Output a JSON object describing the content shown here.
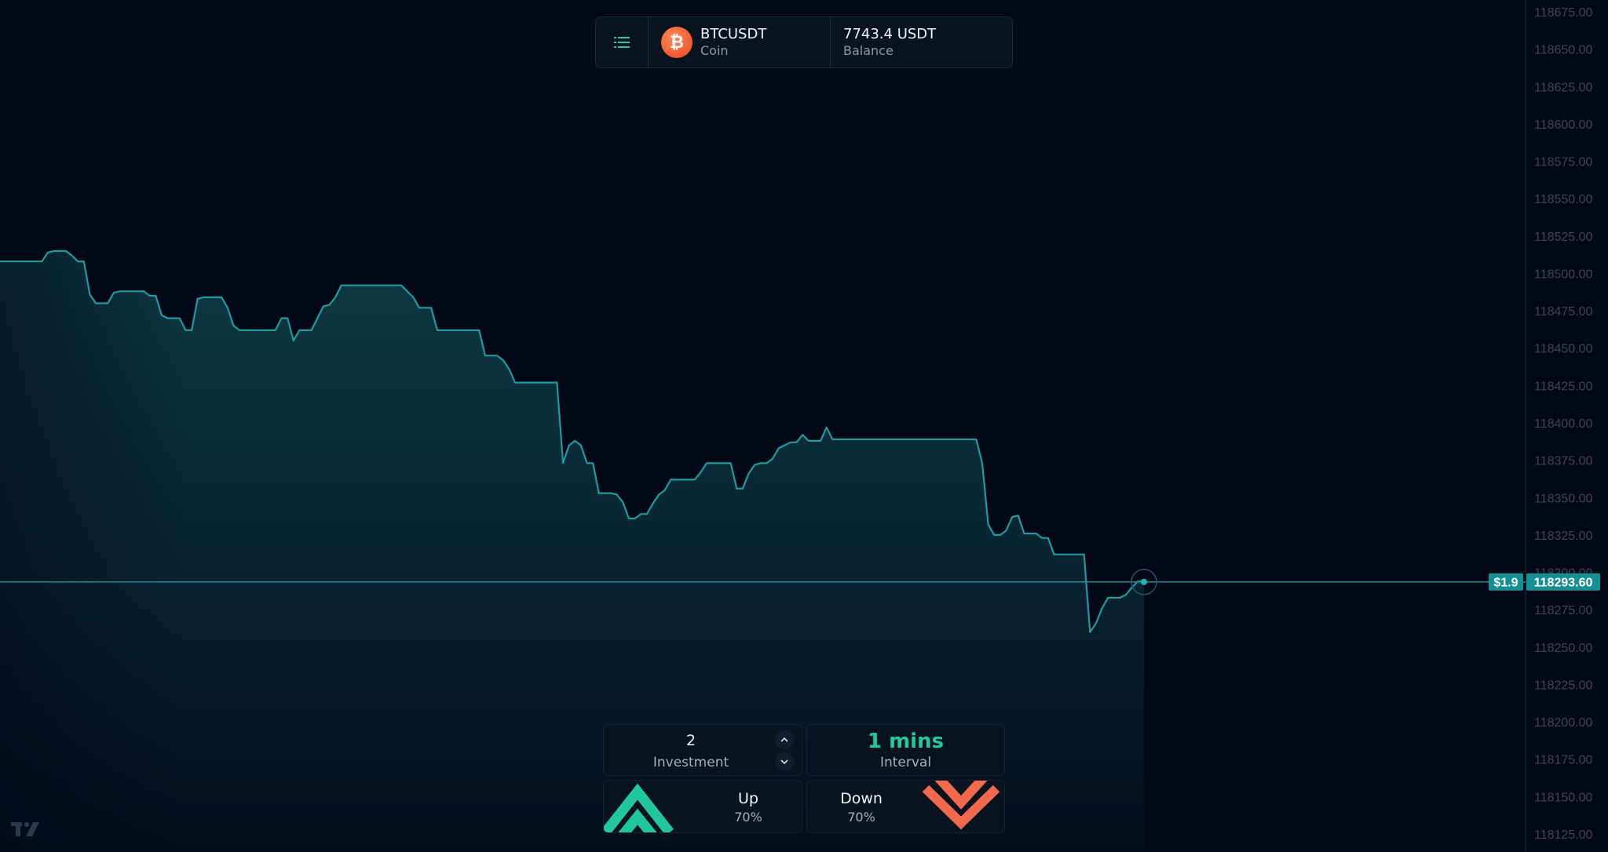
{
  "header": {
    "coin_symbol": "BTCUSDT",
    "coin_label": "Coin",
    "balance_value": "7743.4 USDT",
    "balance_label": "Balance",
    "menu_icon": "list-icon",
    "coin_icon": "bitcoin-icon"
  },
  "controls": {
    "investment_value": "2",
    "investment_label": "Investment",
    "interval_value": "1 mins",
    "interval_label": "Interval",
    "up_label": "Up",
    "up_payout": "70%",
    "down_label": "Down",
    "down_payout": "70%"
  },
  "colors": {
    "line": "#1e9aa0",
    "up": "#1fc79a",
    "down": "#f2694d",
    "background": "#020816"
  },
  "chart_data": {
    "type": "area",
    "y_axis_ticks": [
      "118675.00",
      "118650.00",
      "118625.00",
      "118600.00",
      "118575.00",
      "118550.00",
      "118525.00",
      "118500.00",
      "118475.00",
      "118450.00",
      "118425.00",
      "118400.00",
      "118375.00",
      "118350.00",
      "118325.00",
      "118300.00",
      "118275.00",
      "118250.00",
      "118225.00",
      "118200.00",
      "118175.00",
      "118150.00",
      "118125.00"
    ],
    "ylim": [
      118120,
      118680
    ],
    "current_price": "118293.60",
    "current_price_value": 118293.6,
    "profit_badge": "$1.9",
    "values": [
      118508,
      118508,
      118508,
      118508,
      118508,
      118508,
      118508,
      118508,
      118514,
      118515,
      118515,
      118515,
      118512,
      118508,
      118508,
      118486,
      118480,
      118480,
      118480,
      118487,
      118488,
      118488,
      118488,
      118488,
      118488,
      118485,
      118485,
      118472,
      118470,
      118470,
      118470,
      118462,
      118462,
      118483,
      118484,
      118484,
      118484,
      118484,
      118477,
      118465,
      118462,
      118462,
      118462,
      118462,
      118462,
      118462,
      118462,
      118470,
      118470,
      118455,
      118462,
      118462,
      118462,
      118470,
      118478,
      118479,
      118484,
      118492,
      118492,
      118492,
      118492,
      118492,
      118492,
      118492,
      118492,
      118492,
      118492,
      118492,
      118488,
      118484,
      118477,
      118477,
      118477,
      118462,
      118462,
      118462,
      118462,
      118462,
      118462,
      118462,
      118462,
      118445,
      118445,
      118445,
      118442,
      118436,
      118427,
      118427,
      118427,
      118427,
      118427,
      118427,
      118427,
      118427,
      118373,
      118385,
      118388,
      118385,
      118373,
      118373,
      118353,
      118353,
      118353,
      118352,
      118347,
      118336,
      118336,
      118339,
      118339,
      118346,
      118352,
      118355,
      118362,
      118362,
      118362,
      118362,
      118362,
      118367,
      118373,
      118373,
      118373,
      118373,
      118373,
      118356,
      118356,
      118366,
      118372,
      118373,
      118373,
      118376,
      118383,
      118385,
      118387,
      118387,
      118392,
      118388,
      118388,
      118388,
      118397,
      118389,
      118389,
      118389,
      118389,
      118389,
      118389,
      118389,
      118389,
      118389,
      118389,
      118389,
      118389,
      118389,
      118389,
      118389,
      118389,
      118389,
      118389,
      118389,
      118389,
      118389,
      118389,
      118389,
      118389,
      118389,
      118373,
      118332,
      118325,
      118325,
      118328,
      118337,
      118338,
      118326,
      118326,
      118326,
      118323,
      118323,
      118312,
      118312,
      118312,
      118312,
      118312,
      118312,
      118260,
      118266,
      118276,
      118283,
      118283,
      118283,
      118285,
      118290,
      118294,
      118294
    ]
  }
}
